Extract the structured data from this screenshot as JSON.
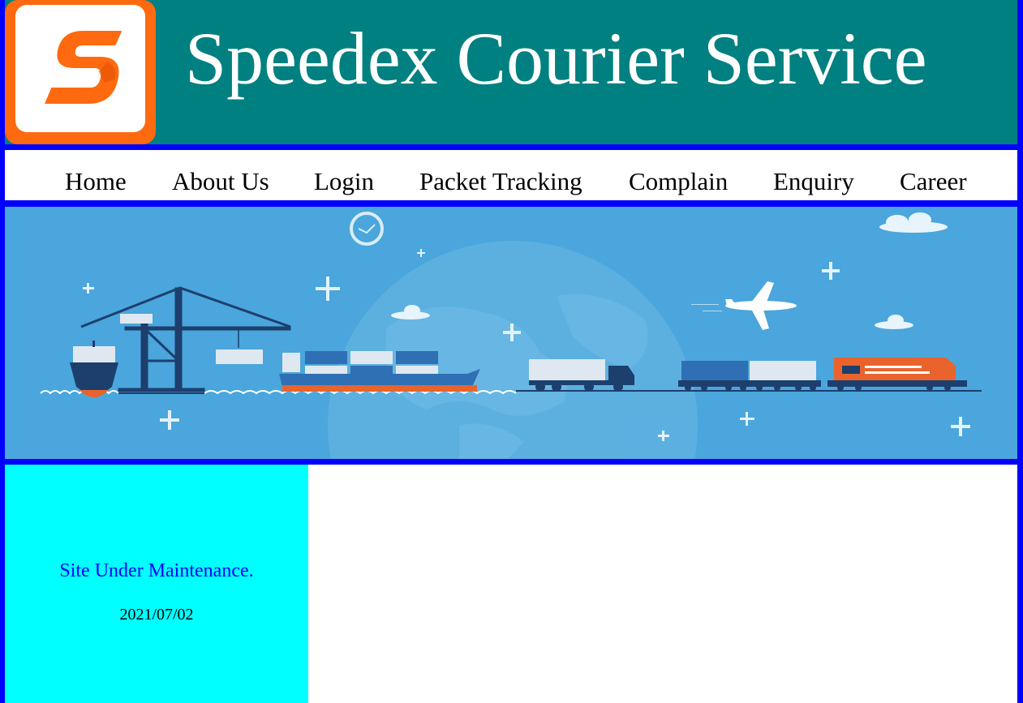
{
  "header": {
    "title": "Speedex Courier Service",
    "logo_icon": "speedex-s-logo-icon",
    "colors": {
      "header_bg": "#008080",
      "logo_orange": "#ff6a10",
      "frame": "#0000ff"
    }
  },
  "nav": {
    "items": [
      {
        "label": "Home"
      },
      {
        "label": "About Us"
      },
      {
        "label": "Login"
      },
      {
        "label": "Packet Tracking"
      },
      {
        "label": "Complain"
      },
      {
        "label": "Enquiry"
      },
      {
        "label": "Career"
      }
    ]
  },
  "banner": {
    "image": "logistics-transport-illustration",
    "colors": {
      "sky": "#4aa6dc",
      "orange": "#e8642c",
      "navy": "#1d3f6e"
    }
  },
  "sidebar": {
    "notice": "Site Under Maintenance.",
    "date": "2021/07/02",
    "colors": {
      "bg": "#00ffff",
      "notice_text": "#0000ff"
    }
  }
}
